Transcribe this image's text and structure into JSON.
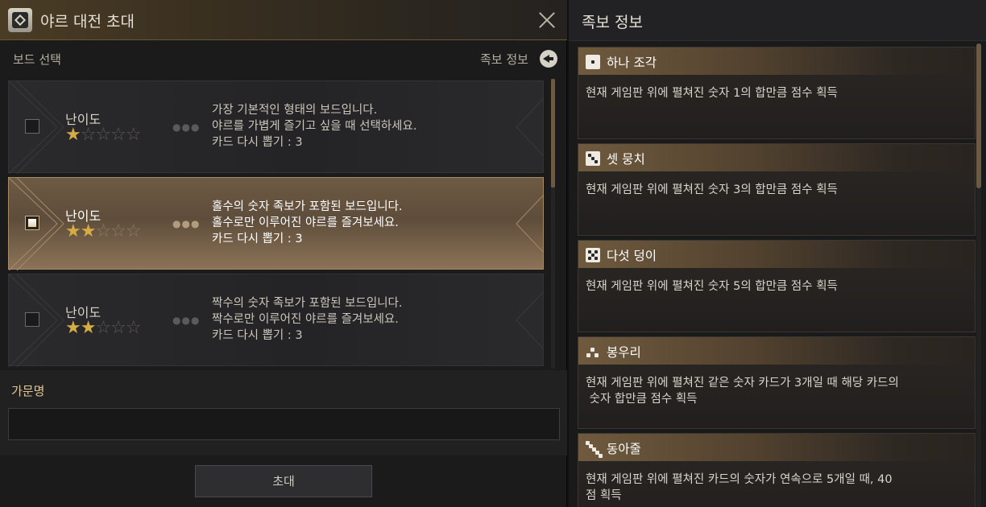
{
  "dialog": {
    "title": "야르 대전 초대"
  },
  "board": {
    "label": "보드 선택",
    "combo_link": "족보 정보",
    "cards": [
      {
        "difficulty_label": "난이도",
        "stars": 1,
        "max_stars": 5,
        "selected": false,
        "description": "가장 기본적인 형태의 보드입니다.\n야르를 가볍게 즐기고 싶을 때 선택하세요.\n카드 다시 뽑기 : 3"
      },
      {
        "difficulty_label": "난이도",
        "stars": 2,
        "max_stars": 5,
        "selected": true,
        "description": "홀수의 숫자 족보가 포함된 보드입니다.\n홀수로만 이루어진 야르를 즐겨보세요.\n카드 다시 뽑기 : 3"
      },
      {
        "difficulty_label": "난이도",
        "stars": 2,
        "max_stars": 5,
        "selected": false,
        "description": "짝수의 숫자 족보가 포함된 보드입니다.\n짝수로만 이루어진 야르를 즐겨보세요.\n카드 다시 뽑기 : 3"
      }
    ]
  },
  "family": {
    "label": "가문명",
    "value": "",
    "placeholder": ""
  },
  "invite_button": "초대",
  "combos": {
    "title": "족보 정보",
    "items": [
      {
        "icon": "die-one-icon",
        "name": "하나 조각",
        "description": "현재 게임판 위에 펼쳐진 숫자 1의 합만큼 점수 획득"
      },
      {
        "icon": "die-three-icon",
        "name": "셋 뭉치",
        "description": "현재 게임판 위에 펼쳐진 숫자 3의 합만큼 점수 획득"
      },
      {
        "icon": "die-five-icon",
        "name": "다섯 덩이",
        "description": "현재 게임판 위에 펼쳐진 숫자 5의 합만큼 점수 획득"
      },
      {
        "icon": "pyramid-dots-icon",
        "name": "봉우리",
        "description": "현재 게임판 위에 펼쳐진 같은 숫자 카드가 3개일 때 해당 카드의\n 숫자 합만큼 점수 획득"
      },
      {
        "icon": "staircase-dots-icon",
        "name": "동아줄",
        "description": "현재 게임판 위에 펼쳐진 카드의 숫자가 연속으로 5개일 때, 40\n점 획득"
      }
    ]
  },
  "colors": {
    "accent": "#d6ad45",
    "selected_card": "#6e5a44",
    "label_gold": "#e0c79a"
  }
}
